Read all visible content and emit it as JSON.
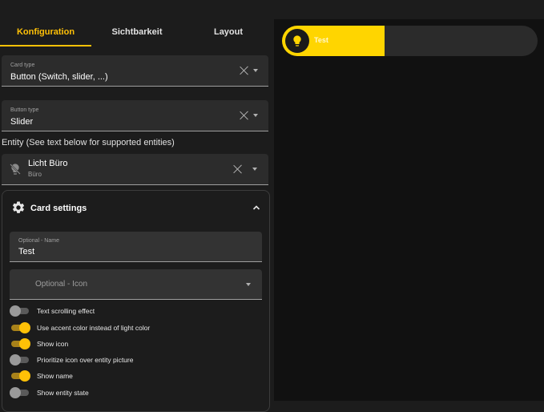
{
  "tabs": [
    {
      "label": "Konfiguration",
      "active": true
    },
    {
      "label": "Sichtbarkeit",
      "active": false
    },
    {
      "label": "Layout",
      "active": false
    }
  ],
  "card_type": {
    "label": "Card type",
    "value": "Button (Switch, slider, ...)"
  },
  "button_type": {
    "label": "Button type",
    "value": "Slider"
  },
  "entity_section": {
    "title": "Entity (See text below for supported entities)"
  },
  "entity": {
    "name": "Licht Büro",
    "area": "Büro",
    "icon": "lightbulb-off-icon"
  },
  "card_settings": {
    "title": "Card settings",
    "name_field": {
      "label": "Optional - Name",
      "value": "Test"
    },
    "icon_field": {
      "placeholder": "Optional - Icon"
    },
    "toggles": [
      {
        "label": "Text scrolling effect",
        "on": false
      },
      {
        "label": "Use accent color instead of light color",
        "on": true
      },
      {
        "label": "Show icon",
        "on": true
      },
      {
        "label": "Prioritize icon over entity picture",
        "on": false
      },
      {
        "label": "Show name",
        "on": true
      },
      {
        "label": "Show entity state",
        "on": false
      }
    ]
  },
  "preview": {
    "name": "Test",
    "fill_fraction": 0.4,
    "fill_color": "#ffd500",
    "icon": "lightbulb-icon"
  },
  "colors": {
    "accent": "#ffc107",
    "background": "#1c1c1c",
    "preview_bg": "#111111"
  }
}
